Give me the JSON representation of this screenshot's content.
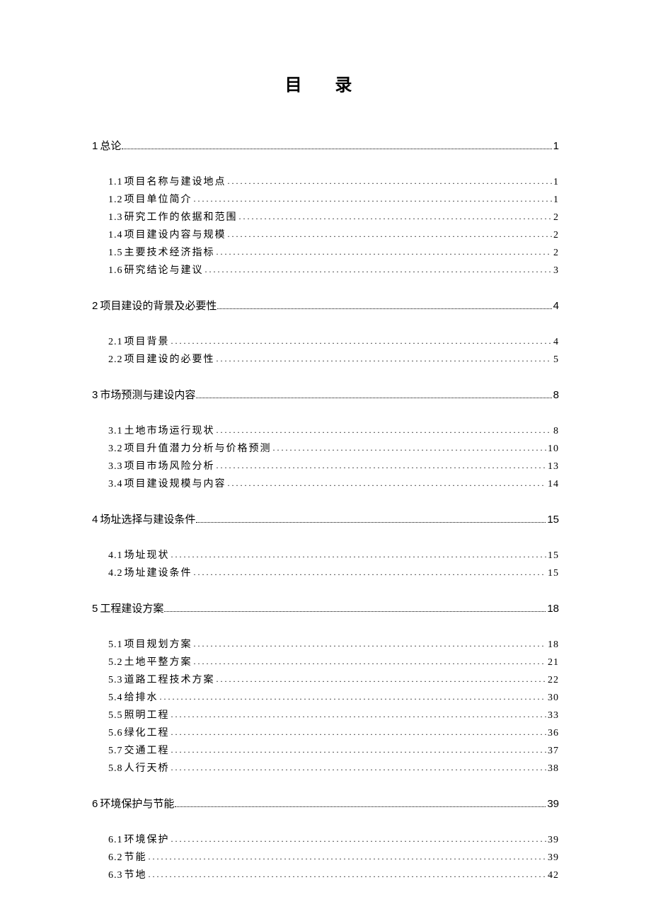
{
  "title": "目 录",
  "sections": [
    {
      "num": "1",
      "text": "总论",
      "page": "1",
      "subs": [
        {
          "num": "1.1",
          "text": "项目名称与建设地点",
          "page": "1"
        },
        {
          "num": "1.2",
          "text": "项目单位简介",
          "page": "1"
        },
        {
          "num": "1.3",
          "text": "研究工作的依据和范围",
          "page": "2"
        },
        {
          "num": "1.4",
          "text": "项目建设内容与规模",
          "page": "2"
        },
        {
          "num": "1.5",
          "text": "主要技术经济指标",
          "page": "2"
        },
        {
          "num": "1.6",
          "text": "研究结论与建议",
          "page": "3"
        }
      ]
    },
    {
      "num": "2",
      "text": "项目建设的背景及必要性",
      "page": "4",
      "subs": [
        {
          "num": "2.1",
          "text": "项目背景",
          "page": "4"
        },
        {
          "num": "2.2",
          "text": "项目建设的必要性",
          "page": "5"
        }
      ]
    },
    {
      "num": "3",
      "text": "市场预测与建设内容",
      "page": "8",
      "subs": [
        {
          "num": "3.1",
          "text": "土地市场运行现状",
          "page": "8"
        },
        {
          "num": "3.2",
          "text": "项目升值潜力分析与价格预测",
          "page": "10"
        },
        {
          "num": "3.3",
          "text": "项目市场风险分析",
          "page": "13"
        },
        {
          "num": "3.4",
          "text": "项目建设规模与内容",
          "page": "14"
        }
      ]
    },
    {
      "num": "4",
      "text": "场址选择与建设条件",
      "page": "15",
      "subs": [
        {
          "num": "4.1",
          "text": "场址现状",
          "page": "15"
        },
        {
          "num": "4.2",
          "text": "场址建设条件",
          "page": "15"
        }
      ]
    },
    {
      "num": "5",
      "text": "工程建设方案",
      "page": "18",
      "subs": [
        {
          "num": "5.1",
          "text": "项目规划方案",
          "page": "18"
        },
        {
          "num": "5.2",
          "text": "土地平整方案",
          "page": "21"
        },
        {
          "num": "5.3",
          "text": " 道路工程技术方案",
          "page": "22"
        },
        {
          "num": "5.4",
          "text": "给排水",
          "page": "30"
        },
        {
          "num": "5.5",
          "text": "照明工程",
          "page": "33"
        },
        {
          "num": "5.6",
          "text": "绿化工程",
          "page": "36"
        },
        {
          "num": "5.7",
          "text": "交通工程",
          "page": "37"
        },
        {
          "num": "5.8",
          "text": "人行天桥",
          "page": "38"
        }
      ]
    },
    {
      "num": "6",
      "text": "环境保护与节能",
      "page": "39",
      "subs": [
        {
          "num": "6.1",
          "text": "环境保护",
          "page": "39"
        },
        {
          "num": "6.2",
          "text": "节能",
          "page": "39"
        },
        {
          "num": "6.3",
          "text": "节地",
          "page": "42"
        }
      ]
    }
  ]
}
